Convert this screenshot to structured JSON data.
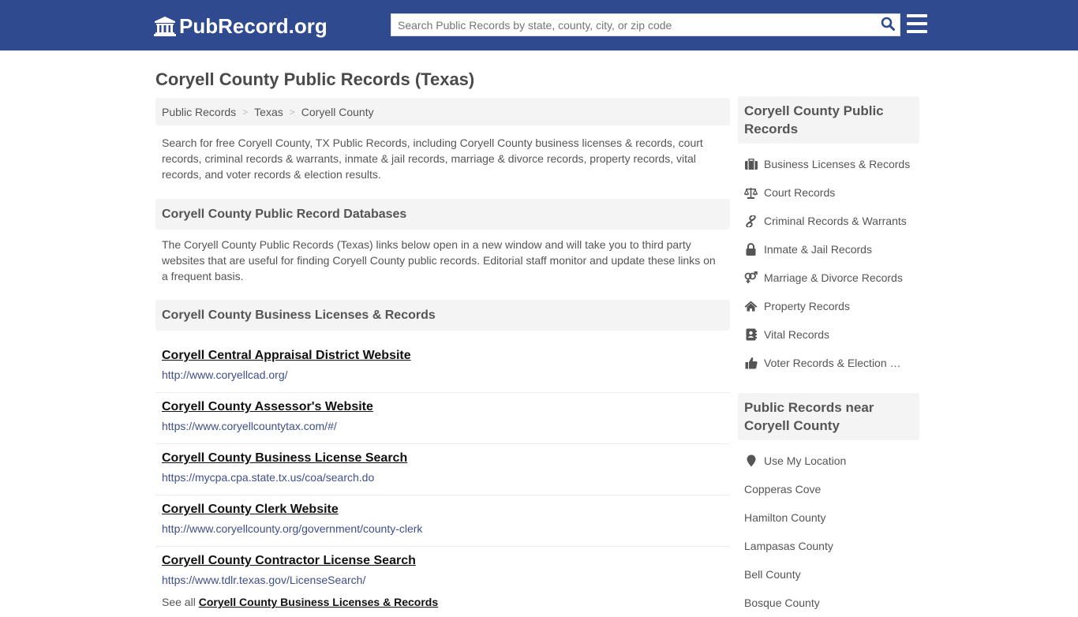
{
  "header": {
    "logo_text": "PubRecord.org",
    "logo_icon": "courthouse-icon",
    "search_placeholder": "Search Public Records by state, county, city, or zip code",
    "search_value": "",
    "search_icon": "search-icon",
    "menu_icon": "hamburger-menu-icon",
    "colors": {
      "bar": "#2f4a8f",
      "search_icon": "#2f4a8f"
    }
  },
  "page": {
    "title": "Coryell County Public Records (Texas)"
  },
  "breadcrumb": [
    {
      "label": "Public Records"
    },
    {
      "label": "Texas"
    },
    {
      "label": "Coryell County"
    }
  ],
  "breadcrumb_separator": ">",
  "intro": "Search for free Coryell County, TX Public Records, including Coryell County business licenses & records, court records, criminal records & warrants, inmate & jail records, marriage & divorce records, property records, vital records, and voter records & election results.",
  "databases": {
    "heading": "Coryell County Public Record Databases",
    "description": "The Coryell County Public Records (Texas) links below open in a new window and will take you to third party websites that are useful for finding Coryell County public records. Editorial staff monitor and update these links on a frequent basis."
  },
  "business": {
    "heading": "Coryell County Business Licenses & Records",
    "links": [
      {
        "title": "Coryell Central Appraisal District Website",
        "url": "http://www.coryellcad.org/"
      },
      {
        "title": "Coryell County Assessor's Website",
        "url": "https://www.coryellcountytax.com/#/"
      },
      {
        "title": "Coryell County Business License Search",
        "url": "https://mycpa.cpa.state.tx.us/coa/search.do"
      },
      {
        "title": "Coryell County Clerk Website",
        "url": "http://www.coryellcounty.org/government/county-clerk"
      },
      {
        "title": "Coryell County Contractor License Search",
        "url": "https://www.tdlr.texas.gov/LicenseSearch/"
      }
    ],
    "see_all_prefix": "See all",
    "see_all_link": "Coryell County Business Licenses & Records"
  },
  "sidebar": {
    "records_heading": "Coryell County Public Records",
    "records": [
      {
        "label": "Business Licenses & Records",
        "icon": "briefcase-icon"
      },
      {
        "label": "Court Records",
        "icon": "balance-scale-icon"
      },
      {
        "label": "Criminal Records & Warrants",
        "icon": "link-icon"
      },
      {
        "label": "Inmate & Jail Records",
        "icon": "lock-icon"
      },
      {
        "label": "Marriage & Divorce Records",
        "icon": "venus-mars-icon"
      },
      {
        "label": "Property Records",
        "icon": "home-icon"
      },
      {
        "label": "Vital Records",
        "icon": "address-book-icon"
      },
      {
        "label": "Voter Records & Election Results",
        "icon": "thumbs-up-icon"
      }
    ],
    "near_heading": "Public Records near Coryell County",
    "near": [
      {
        "label": "Use My Location",
        "icon": "map-marker-icon"
      },
      {
        "label": "Copperas Cove"
      },
      {
        "label": "Hamilton County"
      },
      {
        "label": "Lampasas County"
      },
      {
        "label": "Bell County"
      },
      {
        "label": "Bosque County"
      }
    ]
  }
}
